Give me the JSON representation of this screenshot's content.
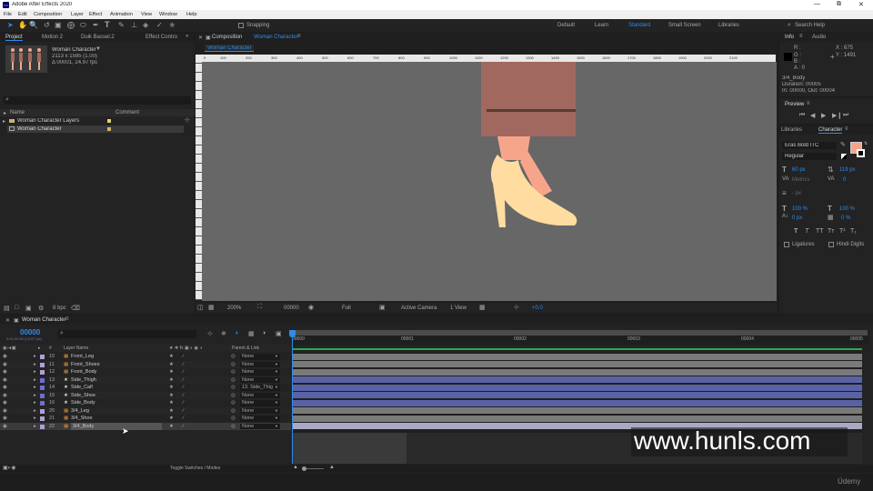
{
  "app": {
    "title": "Adobe After Effects 2020",
    "icon": "Ae"
  },
  "menu": [
    "File",
    "Edit",
    "Composition",
    "Layer",
    "Effect",
    "Animation",
    "View",
    "Window",
    "Help"
  ],
  "toolbar": {
    "snapping": "Snapping"
  },
  "workspaces": [
    "Default",
    "Learn",
    "Standard",
    "Small Screen",
    "Libraries"
  ],
  "search_help": "Search Help",
  "project_tabs": [
    "Project",
    "Motion 2",
    "Duik Bassel.2",
    "Effect Contro"
  ],
  "project_preview": {
    "name": "Woman Character",
    "dims": "2113 x 1595 (1.00)",
    "duration": "Δ 00001, 24.97 fps"
  },
  "project_columns": {
    "name": "Name",
    "comment": "Comment"
  },
  "project_items": [
    {
      "label": "Woman Character Layers",
      "type": "folder"
    },
    {
      "label": "Woman Character",
      "type": "comp"
    }
  ],
  "project_footer": {
    "bpc": "8 bpc"
  },
  "comp_panel": {
    "tab": "Composition",
    "comp_name": "Woman Character",
    "sub_tab": "Woman Character"
  },
  "ruler_ticks": [
    "0",
    "100",
    "200",
    "300",
    "400",
    "500",
    "600",
    "700",
    "800",
    "900",
    "1000",
    "1100",
    "1200",
    "1300",
    "1400",
    "1500",
    "1600",
    "1700",
    "1800",
    "1900",
    "2000",
    "2100"
  ],
  "viewer_bar": {
    "zoom": "200%",
    "time": "00000",
    "resolution": "Full",
    "camera": "Active Camera",
    "views": "1 View",
    "exposure": "+0.0"
  },
  "info_tabs": [
    "Info",
    "Audio"
  ],
  "info": {
    "x": "X : 675",
    "y": "Y : 1491",
    "r": "R :",
    "g": "G :",
    "b": "B :",
    "a": "A : 0",
    "layer": "3/4_Body",
    "duration": "Duration: 00005",
    "in_out": "In: 00000, Out: 00004"
  },
  "preview": {
    "title": "Preview"
  },
  "character_tabs": [
    "Libraries",
    "Character"
  ],
  "character": {
    "font": "Eras Bold ITC",
    "style": "Regular",
    "size": "60 px",
    "leading": "119 px",
    "kerning": "Metrics",
    "tracking": "0",
    "stroke": "- px",
    "vscale": "100 %",
    "hscale": "100 %",
    "baseline": "0 px",
    "tsume": "0 %",
    "ligatures": "Ligatures",
    "hindi": "Hindi Digits",
    "fill_color": "#f7a58a"
  },
  "timeline": {
    "tab": "Woman Character",
    "timecode": "00000",
    "timecode_sub": "0:00:00:00 (24.97 fps)",
    "footer": "Toggle Switches / Modes",
    "parent_header": "Parent & Link",
    "layer_header": "Layer Name"
  },
  "time_ruler": [
    "00000",
    "00001",
    "00002",
    "00003",
    "00004",
    "00005"
  ],
  "layers": [
    {
      "num": "10",
      "name": "Front_Leg",
      "parent": "None",
      "color": "#b0a0d8",
      "bar": "#7a7a7a",
      "type": "img"
    },
    {
      "num": "11",
      "name": "Front_Shoes",
      "parent": "None",
      "color": "#b0a0d8",
      "bar": "#7a7a7a",
      "type": "img"
    },
    {
      "num": "12",
      "name": "Front_Body",
      "parent": "None",
      "color": "#b0a0d8",
      "bar": "#7a7a7a",
      "type": "img"
    },
    {
      "num": "13",
      "name": "Side_Thigh",
      "parent": "None",
      "color": "#6e6ed0",
      "bar": "#5a62a6",
      "type": "star"
    },
    {
      "num": "14",
      "name": "Side_Calf",
      "parent": "13. Side_Thig",
      "color": "#6e6ed0",
      "bar": "#5a62a6",
      "type": "star"
    },
    {
      "num": "15",
      "name": "Side_Shoe",
      "parent": "None",
      "color": "#6e6ed0",
      "bar": "#5a62a6",
      "type": "star"
    },
    {
      "num": "16",
      "name": "Side_Body",
      "parent": "None",
      "color": "#6e6ed0",
      "bar": "#5a62a6",
      "type": "star"
    },
    {
      "num": "20",
      "name": "3/4_Leg",
      "parent": "None",
      "color": "#b0a0d8",
      "bar": "#7a7a7a",
      "type": "img"
    },
    {
      "num": "21",
      "name": "3/4_Shoe",
      "parent": "None",
      "color": "#b0a0d8",
      "bar": "#7a7a7a",
      "type": "img"
    },
    {
      "num": "22",
      "name": "3/4_Body",
      "parent": "None",
      "color": "#b0a0d8",
      "bar": "#a9a9c6",
      "type": "img",
      "selected": true
    }
  ],
  "watermark": "www.hunls.com",
  "udemy": "Údemy"
}
